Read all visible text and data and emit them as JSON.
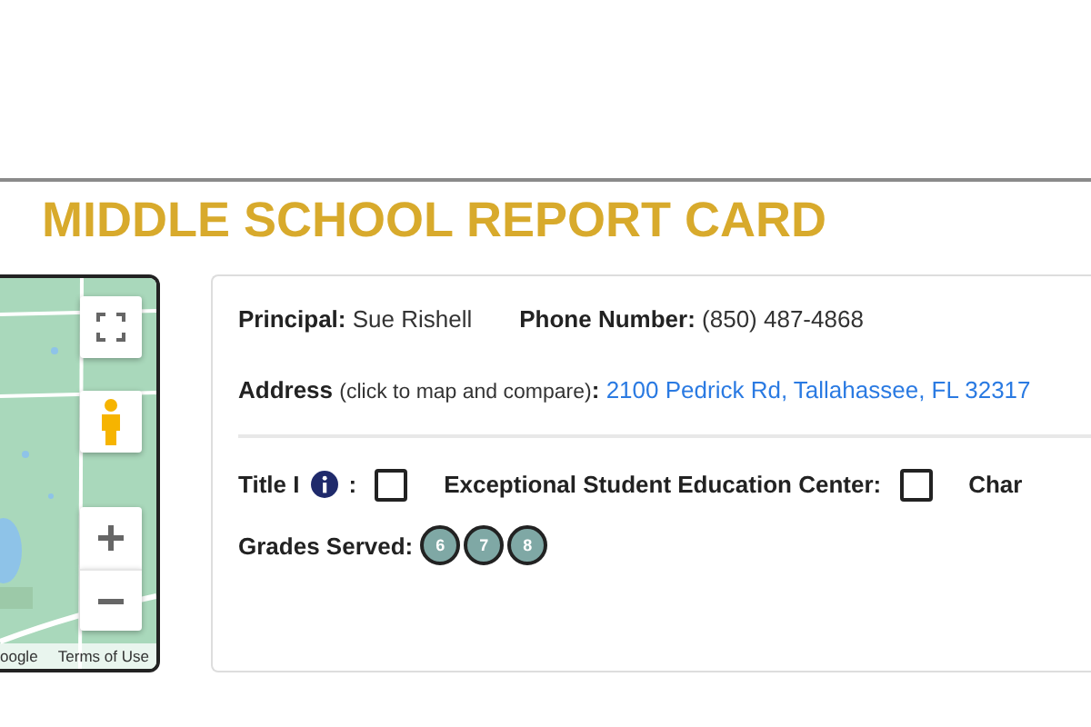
{
  "title": "MIDDLE SCHOOL REPORT CARD",
  "map": {
    "attribution": "oogle",
    "terms": "Terms of Use"
  },
  "info": {
    "principal_label": "Principal:",
    "principal": "Sue Rishell",
    "phone_label": "Phone Number:",
    "phone": "(850) 487-4868",
    "address_label": "Address",
    "address_note": "(click to map and compare)",
    "address_colon": ":",
    "address": "2100 Pedrick Rd, Tallahassee, FL 32317"
  },
  "flags": [
    {
      "label": "Title I",
      "info": true,
      "colon": ":",
      "checked": false
    },
    {
      "label": "Exceptional Student Education Center:",
      "checked": false
    },
    {
      "label": "Char"
    }
  ],
  "grades_label": "Grades Served:",
  "grades": [
    "6",
    "7",
    "8"
  ]
}
